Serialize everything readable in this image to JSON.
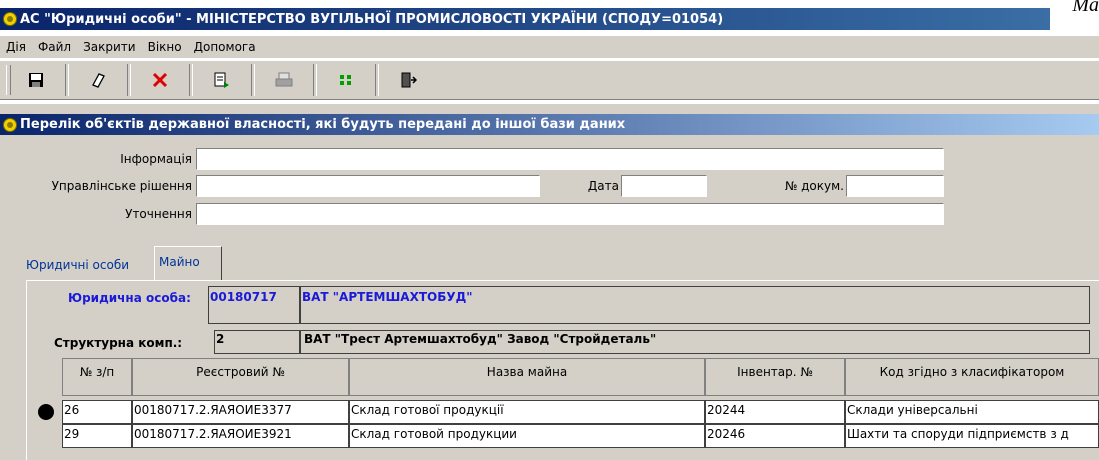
{
  "corner_text": "Ma",
  "window": {
    "title": "АС \"Юридичні особи\" - МІНІСТЕРСТВО ВУГІЛЬНОЇ ПРОМИСЛОВОСТІ УКРАЇНИ (СПОДУ=01054)",
    "icon": "app-icon"
  },
  "menu": [
    "Дія",
    "Файл",
    "Закрити",
    "Вікно",
    "Допомога"
  ],
  "toolbar": [
    {
      "icon": "save-icon",
      "glyph": "💾"
    },
    {
      "icon": "eraser-icon",
      "glyph": "⌀"
    },
    {
      "icon": "delete-icon",
      "glyph": "✕"
    },
    {
      "icon": "export-document-icon",
      "glyph": "🖹"
    },
    {
      "icon": "print-icon",
      "glyph": "⎙"
    },
    {
      "icon": "grid-icon",
      "glyph": "▪▪"
    },
    {
      "icon": "exit-door-icon",
      "glyph": "⇥"
    }
  ],
  "form": {
    "title": "Перелік об'єктів державної власності, які будуть передані до іншої бази даних",
    "labels": {
      "info": "Інформація",
      "decision": "Управлінське рішення",
      "date": "Дата",
      "doc_no": "№ докум.",
      "clarification": "Уточнення"
    },
    "values": {
      "info": "",
      "decision": "",
      "date": "",
      "doc_no": "",
      "clarification": ""
    }
  },
  "tabs": [
    {
      "label": "Юридичні особи",
      "active": false
    },
    {
      "label": "Майно",
      "active": true
    }
  ],
  "panel": {
    "legal_entity_label": "Юридична особа:",
    "legal_entity_code": "00180717",
    "legal_entity_name": "ВАТ \"АРТЕМШАХТОБУД\"",
    "struct_label": "Структурна комп.:",
    "struct_code": "2",
    "struct_name": "ВАТ \"Трест Артемшахтобуд\" Завод \"Стройдеталь\""
  },
  "table": {
    "headers": [
      "№ з/п",
      "Реєстровий №",
      "Назва майна",
      "Інвентар. №",
      "Код згідно з класифікатором"
    ],
    "rows": [
      {
        "num": "26",
        "reg": "00180717.2.ЯАЯОИЕ3377",
        "name": "Склад готової продукції",
        "inv": "20244",
        "code": "Склади універсальні",
        "current": true
      },
      {
        "num": "29",
        "reg": "00180717.2.ЯАЯОИЕ3921",
        "name": "Склад готовой продукции",
        "inv": "20246",
        "code": "Шахти та споруди підприємств з д",
        "current": false
      }
    ]
  }
}
